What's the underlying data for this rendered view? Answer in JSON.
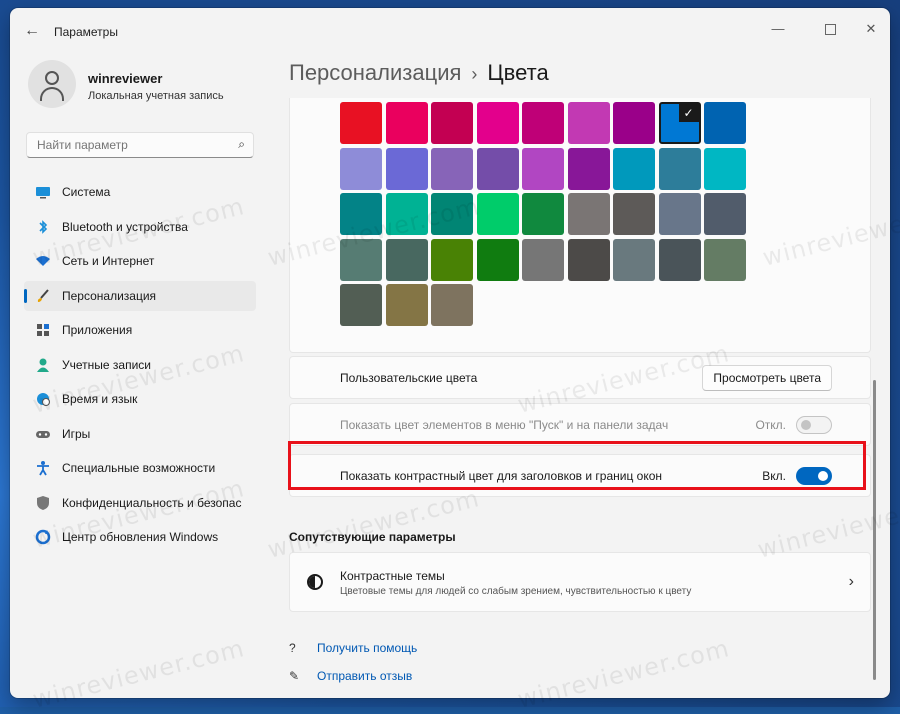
{
  "window": {
    "app_title": "Параметры",
    "back_icon": "arrow-left-icon",
    "controls": {
      "minimize": "—",
      "close": "✕"
    }
  },
  "profile": {
    "name": "winreviewer",
    "account_type": "Локальная учетная запись"
  },
  "search": {
    "placeholder": "Найти параметр",
    "icon": "search-icon"
  },
  "sidebar": {
    "items": [
      {
        "label": "Система",
        "icon": "monitor-icon"
      },
      {
        "label": "Bluetooth и устройства",
        "icon": "bluetooth-icon"
      },
      {
        "label": "Сеть и Интернет",
        "icon": "wifi-icon"
      },
      {
        "label": "Персонализация",
        "icon": "brush-icon",
        "active": true
      },
      {
        "label": "Приложения",
        "icon": "apps-icon"
      },
      {
        "label": "Учетные записи",
        "icon": "person-icon"
      },
      {
        "label": "Время и язык",
        "icon": "globe-clock-icon"
      },
      {
        "label": "Игры",
        "icon": "gamepad-icon"
      },
      {
        "label": "Специальные возможности",
        "icon": "accessibility-icon"
      },
      {
        "label": "Конфиденциальность и безопас",
        "icon": "shield-icon"
      },
      {
        "label": "Центр обновления Windows",
        "icon": "update-icon"
      }
    ]
  },
  "header": {
    "breadcrumb_parent": "Персонализация",
    "separator": "›",
    "title": "Цвета"
  },
  "accent_colors": [
    [
      "#e81123",
      "#ea005e",
      "#c30052",
      "#e3008c",
      "#bf0077",
      "#c239b3",
      "#9a0089",
      "#0078d4",
      "#0063b1"
    ],
    [
      "#8e8cd8",
      "#6b69d6",
      "#8764b8",
      "#744da9",
      "#b146c2",
      "#881798",
      "#0099bc",
      "#2d7d9a",
      "#00b7c3"
    ],
    [
      "#038387",
      "#00b294",
      "#018574",
      "#00cc6a",
      "#10893e",
      "#7a7574",
      "#5d5a58",
      "#68768a",
      "#515c6b"
    ],
    [
      "#567c73",
      "#486860",
      "#498205",
      "#107c10",
      "#767676",
      "#4c4a48",
      "#69797e",
      "#4a5459",
      "#647c64"
    ],
    [
      "#525e54",
      "#847545",
      "#7e735f"
    ]
  ],
  "selected_color": "#0078d4",
  "custom_colors": {
    "label": "Пользовательские цвета",
    "button": "Просмотреть цвета"
  },
  "start_taskbar": {
    "label": "Показать цвет элементов в меню \"Пуск\" и на панели задач",
    "state": "Откл.",
    "enabled": false
  },
  "title_bars": {
    "label": "Показать контрастный цвет для заголовков и границ окон",
    "state": "Вкл.",
    "enabled": true
  },
  "related": {
    "section_title": "Сопутствующие параметры",
    "item_title": "Контрастные темы",
    "item_subtitle": "Цветовые темы для людей со слабым зрением, чувствительностью к цвету"
  },
  "links": {
    "help": "Получить помощь",
    "feedback": "Отправить отзыв"
  },
  "highlight_color": "#e8111a",
  "watermark": "winreviewer.com"
}
